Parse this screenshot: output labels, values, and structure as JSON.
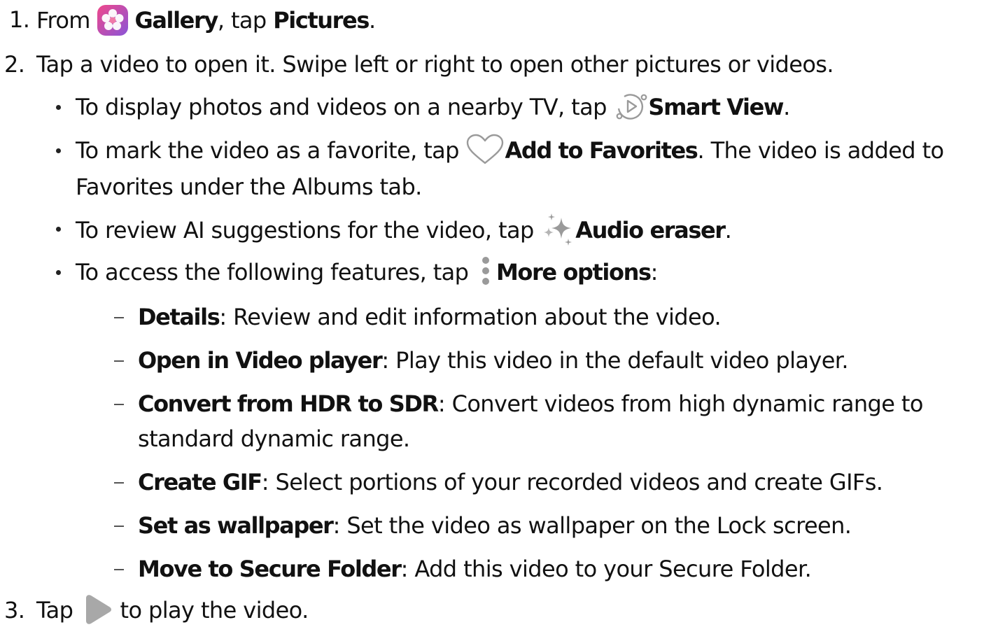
{
  "steps": [
    {
      "number": "1.",
      "before": "From ",
      "icon": "gallery-app-icon",
      "bold1": "Gallery",
      "middle": ", tap ",
      "bold2": "Pictures",
      "after": "."
    },
    {
      "number": "2.",
      "text": "Tap a video to open it. Swipe left or right to open other pictures or videos."
    },
    {
      "number": "3.",
      "before": "Tap ",
      "icon": "play-icon",
      "after": " to play the video."
    }
  ],
  "bullets": [
    {
      "before": "To display photos and videos on a nearby TV, tap ",
      "icon": "smart-view-icon",
      "bold": "Smart View",
      "after": "."
    },
    {
      "before": "To mark the video as a favorite, tap ",
      "icon": "heart-icon",
      "bold": "Add to Favorites",
      "after": ". The video is added to",
      "continuation": "Favorites under the Albums tab."
    },
    {
      "before": "To review AI suggestions for the video, tap ",
      "icon": "sparkle-icon",
      "bold": "Audio eraser",
      "after": "."
    },
    {
      "before": "To access the following features, tap ",
      "icon": "more-options-icon",
      "bold": "More options",
      "after": ":"
    }
  ],
  "sub_items": [
    {
      "term": "Details",
      "sep": ":",
      "desc": " Review and edit information about the video."
    },
    {
      "term": "Open in Video player",
      "sep": ":",
      "desc": " Play this video in the default video player."
    },
    {
      "term": "Convert from HDR to SDR",
      "sep": ":",
      "desc": " Convert videos from high dynamic range to",
      "continuation": "standard dynamic range."
    },
    {
      "term": "Create GIF",
      "sep": ":",
      "desc": " Select portions of your recorded videos and create GIFs."
    },
    {
      "term": "Set as wallpaper",
      "sep": ":",
      "desc": " Set the video as wallpaper on the Lock screen."
    },
    {
      "term": "Move to Secure Folder",
      "sep": ":",
      "desc": " Add this video to your Secure Folder."
    }
  ],
  "colors": {
    "text": "#111111",
    "icon_gray": "#9a9a9a",
    "gallery_pink": "#e24b8c",
    "gallery_purple": "#8a5bd6"
  }
}
